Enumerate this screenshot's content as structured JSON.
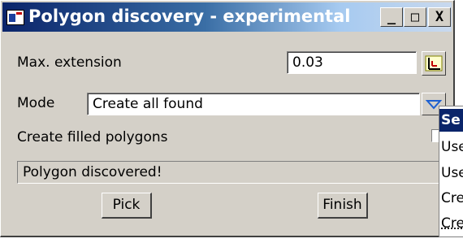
{
  "window": {
    "title": "Polygon discovery - experimental",
    "minimize_glyph": "_",
    "maximize_glyph": "□",
    "close_glyph": "X"
  },
  "form": {
    "max_extension_label": "Max. extension",
    "max_extension_value": "0.03",
    "mode_label": "Mode",
    "mode_value": "Create all found",
    "filled_label": "Create filled polygons",
    "status_text": "Polygon discovered!"
  },
  "buttons": {
    "pick": "Pick",
    "finish": "Finish"
  },
  "dropdown": {
    "items": [
      "Se",
      "Use",
      "Use",
      "Cre",
      "Cre"
    ]
  },
  "colors": {
    "title_bar": "#0a246a",
    "face": "#d4d0c8",
    "selection": "#0a246a"
  }
}
